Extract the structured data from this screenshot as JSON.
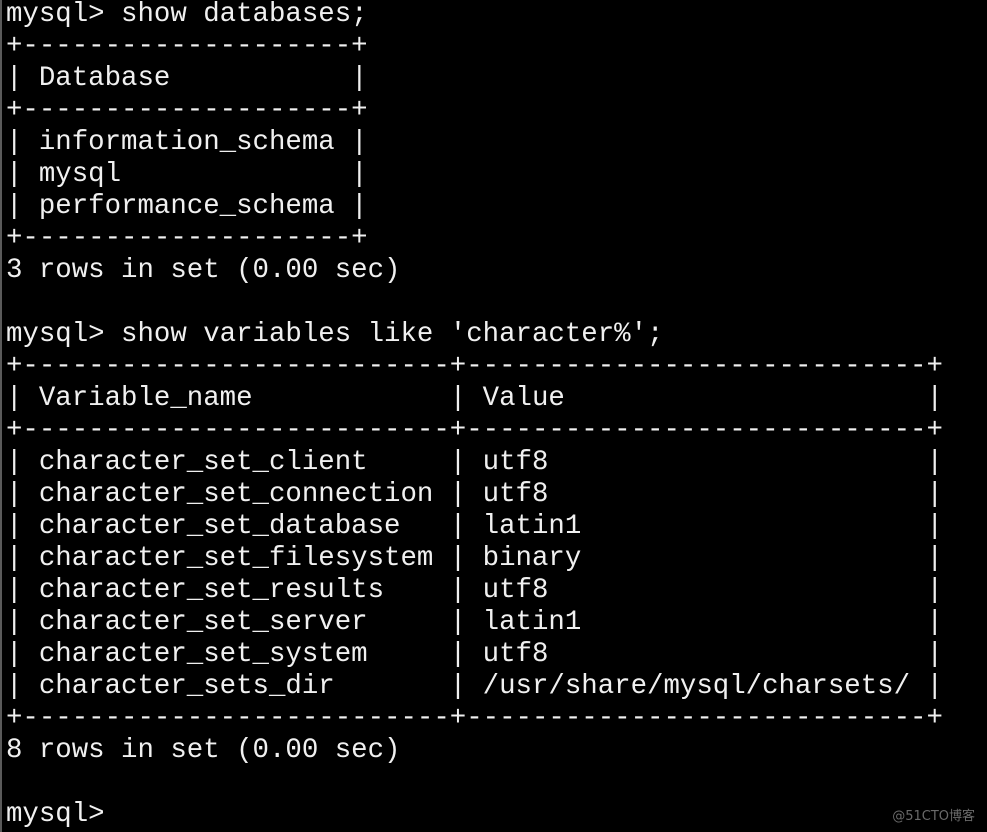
{
  "terminal": {
    "prompt": "mysql>",
    "session": [
      {
        "command": "show databases;",
        "table": {
          "headers": [
            "Database"
          ],
          "rows": [
            [
              "information_schema"
            ],
            [
              "mysql"
            ],
            [
              "performance_schema"
            ]
          ]
        },
        "summary": "3 rows in set (0.00 sec)"
      },
      {
        "command": "show variables like 'character%';",
        "table": {
          "headers": [
            "Variable_name",
            "Value"
          ],
          "rows": [
            [
              "character_set_client",
              "utf8"
            ],
            [
              "character_set_connection",
              "utf8"
            ],
            [
              "character_set_database",
              "latin1"
            ],
            [
              "character_set_filesystem",
              "binary"
            ],
            [
              "character_set_results",
              "utf8"
            ],
            [
              "character_set_server",
              "latin1"
            ],
            [
              "character_set_system",
              "utf8"
            ],
            [
              "character_sets_dir",
              "/usr/share/mysql/charsets/"
            ]
          ]
        },
        "summary": "8 rows in set (0.00 sec)"
      }
    ],
    "final_prompt": "mysql>",
    "colors": {
      "background": "#000000",
      "foreground": "#f0f0f0"
    }
  },
  "watermark": "@51CTO博客"
}
